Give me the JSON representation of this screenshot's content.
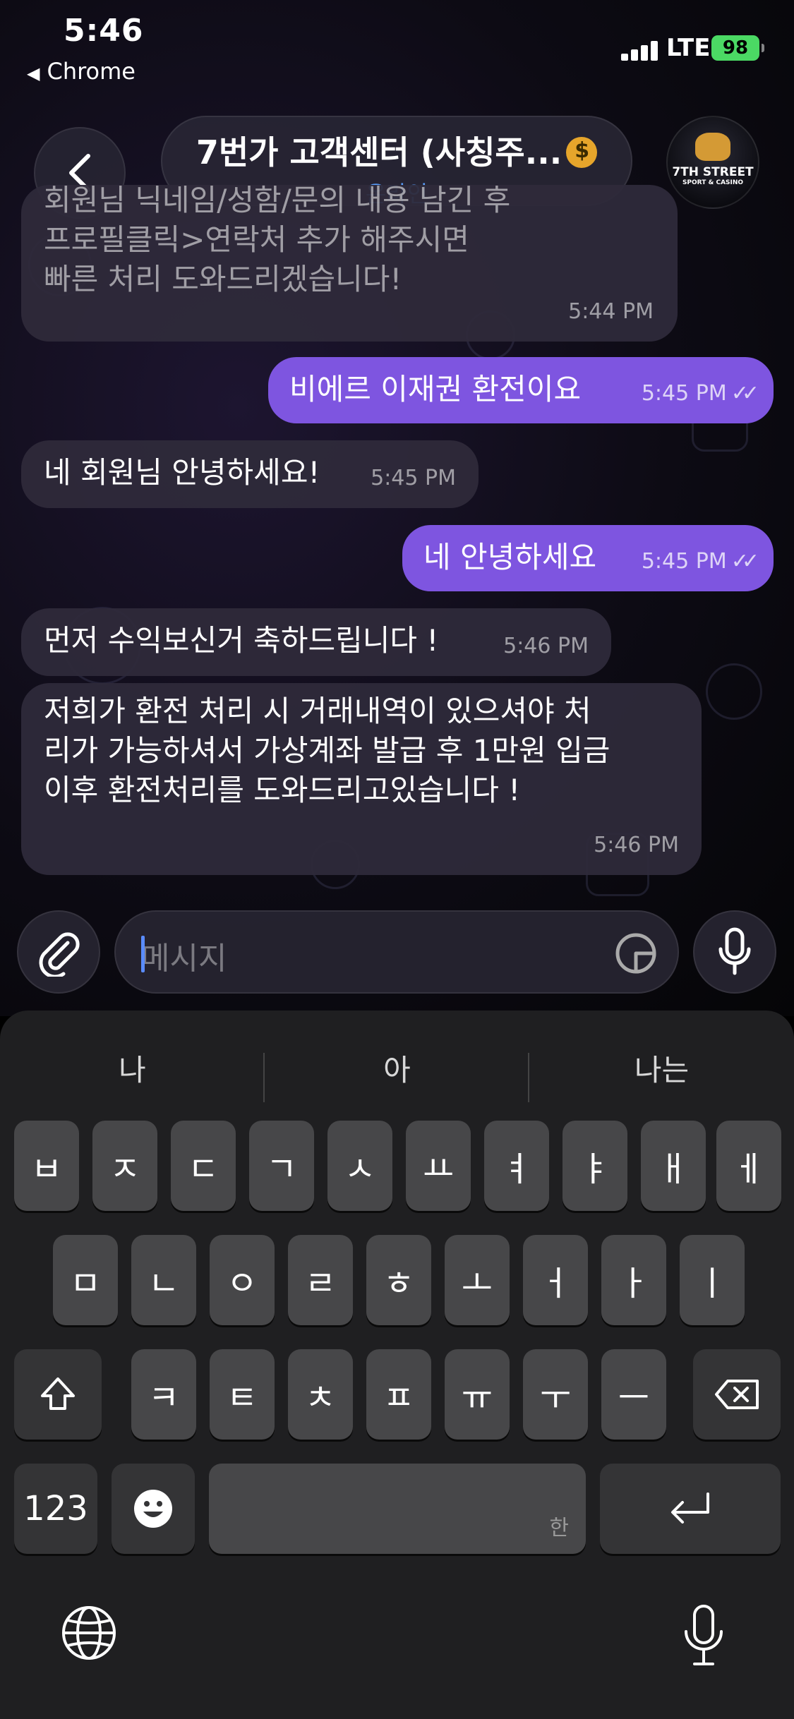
{
  "status_bar": {
    "time": "5:46",
    "back_app": "Chrome",
    "network": "LTE",
    "battery": "98"
  },
  "header": {
    "title": "7번가 고객센터 (사칭주...",
    "subtitle": "온라인",
    "avatar_line1": "7TH STREET",
    "avatar_line2": "SPORT & CASINO"
  },
  "messages": [
    {
      "dir": "in",
      "text": "회원님 닉네임/성함/문의 내용 남긴 후\n프로필클릭>연락처 추가 해주시면\n빠른 처리 도와드리겠습니다!",
      "time": "5:44 PM"
    },
    {
      "dir": "out",
      "text": "비에르 이재권 환전이요",
      "time": "5:45 PM"
    },
    {
      "dir": "in",
      "text": "네 회원님 안녕하세요!",
      "time": "5:45 PM"
    },
    {
      "dir": "out",
      "text": "네 안녕하세요",
      "time": "5:45 PM"
    },
    {
      "dir": "in",
      "text": "먼저 수익보신거 축하드립니다 !",
      "time": "5:46 PM"
    },
    {
      "dir": "in",
      "text": "저희가 환전 처리 시 거래내역이 있으셔야 처\n리가 가능하셔서 가상계좌 발급 후 1만원 입금\n이후 환전처리를 도와드리고있습니다 !",
      "time": "5:46 PM"
    }
  ],
  "composer": {
    "placeholder": "메시지"
  },
  "keyboard": {
    "suggestions": [
      "나",
      "아",
      "나는"
    ],
    "row1": [
      "ㅂ",
      "ㅈ",
      "ㄷ",
      "ㄱ",
      "ㅅ",
      "ㅛ",
      "ㅕ",
      "ㅑ",
      "ㅐ",
      "ㅔ"
    ],
    "row2": [
      "ㅁ",
      "ㄴ",
      "ㅇ",
      "ㄹ",
      "ㅎ",
      "ㅗ",
      "ㅓ",
      "ㅏ",
      "ㅣ"
    ],
    "row3": [
      "ㅋ",
      "ㅌ",
      "ㅊ",
      "ㅍ",
      "ㅠ",
      "ㅜ",
      "ㅡ"
    ],
    "numbers_key": "123",
    "space_label": "한"
  },
  "colors": {
    "outgoing_bubble": "#7e55e0",
    "incoming_bubble": "#2e2a3a",
    "online": "#5aa0ff",
    "battery": "#4bd964"
  }
}
